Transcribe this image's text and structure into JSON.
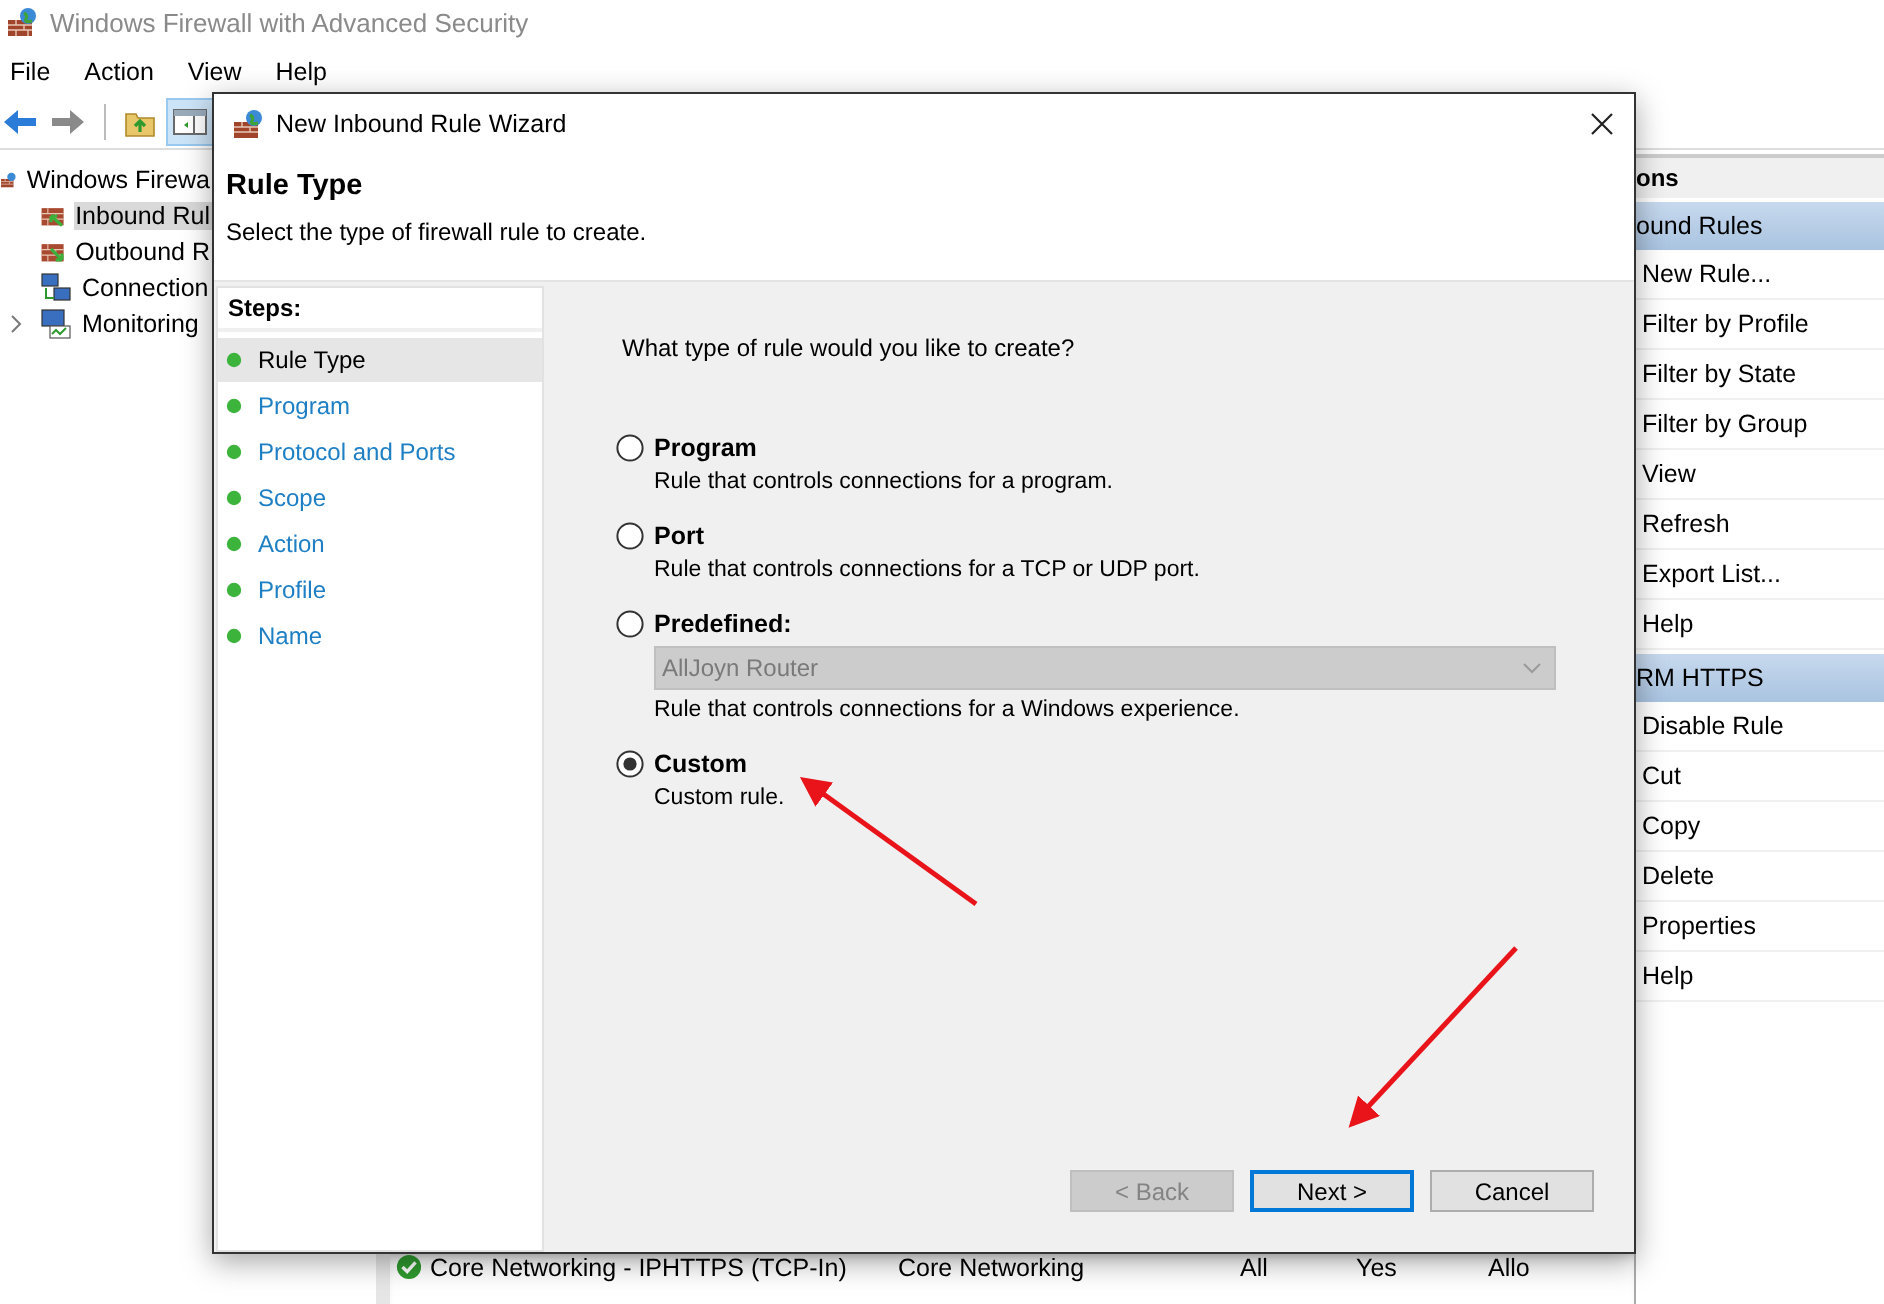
{
  "window": {
    "title": "Windows Firewall with Advanced Security"
  },
  "menu": [
    "File",
    "Action",
    "View",
    "Help"
  ],
  "tree": {
    "root": "Windows Firewa",
    "items": [
      {
        "label": "Inbound Rul",
        "selected": true,
        "collapsed": false,
        "kind": "inbound"
      },
      {
        "label": "Outbound R",
        "selected": false,
        "collapsed": false,
        "kind": "outbound"
      },
      {
        "label": "Connection",
        "selected": false,
        "collapsed": false,
        "kind": "connection"
      },
      {
        "label": "Monitoring",
        "selected": false,
        "collapsed": true,
        "kind": "monitoring"
      }
    ]
  },
  "rules_table": {
    "rows": [
      {
        "name": "Core Networking - IPHTTPS (TCP-In)",
        "group": "Core Networking",
        "profile": "All",
        "enabled": "Yes",
        "action": "Allo"
      }
    ]
  },
  "actions": {
    "header": "ons",
    "sections": [
      {
        "title": "ound Rules",
        "items": [
          "New Rule...",
          "Filter by Profile",
          "Filter by State",
          "Filter by Group",
          "View",
          "Refresh",
          "Export List...",
          "Help"
        ]
      },
      {
        "title": "RM HTTPS",
        "items": [
          "Disable Rule",
          "Cut",
          "Copy",
          "Delete",
          "Properties",
          "Help"
        ]
      }
    ]
  },
  "dialog": {
    "title": "New Inbound Rule Wizard",
    "heading": "Rule Type",
    "subtitle": "Select the type of firewall rule to create.",
    "steps_label": "Steps:",
    "steps": [
      {
        "label": "Rule Type",
        "selected": true
      },
      {
        "label": "Program",
        "selected": false
      },
      {
        "label": "Protocol and Ports",
        "selected": false
      },
      {
        "label": "Scope",
        "selected": false
      },
      {
        "label": "Action",
        "selected": false
      },
      {
        "label": "Profile",
        "selected": false
      },
      {
        "label": "Name",
        "selected": false
      }
    ],
    "question": "What type of rule would you like to create?",
    "options": [
      {
        "label": "Program",
        "description": "Rule that controls connections for a program.",
        "selected": false
      },
      {
        "label": "Port",
        "description": "Rule that controls connections for a TCP or UDP port.",
        "selected": false
      },
      {
        "label": "Predefined:",
        "description": "Rule that controls connections for a Windows experience.",
        "selected": false,
        "dropdown": {
          "value": "AllJoyn Router",
          "disabled": true
        }
      },
      {
        "label": "Custom",
        "description": "Custom rule.",
        "selected": true
      }
    ],
    "buttons": [
      {
        "label": "< Back",
        "disabled": true,
        "default": false
      },
      {
        "label": "Next >",
        "disabled": false,
        "default": true
      },
      {
        "label": "Cancel",
        "disabled": false,
        "default": false
      }
    ]
  }
}
